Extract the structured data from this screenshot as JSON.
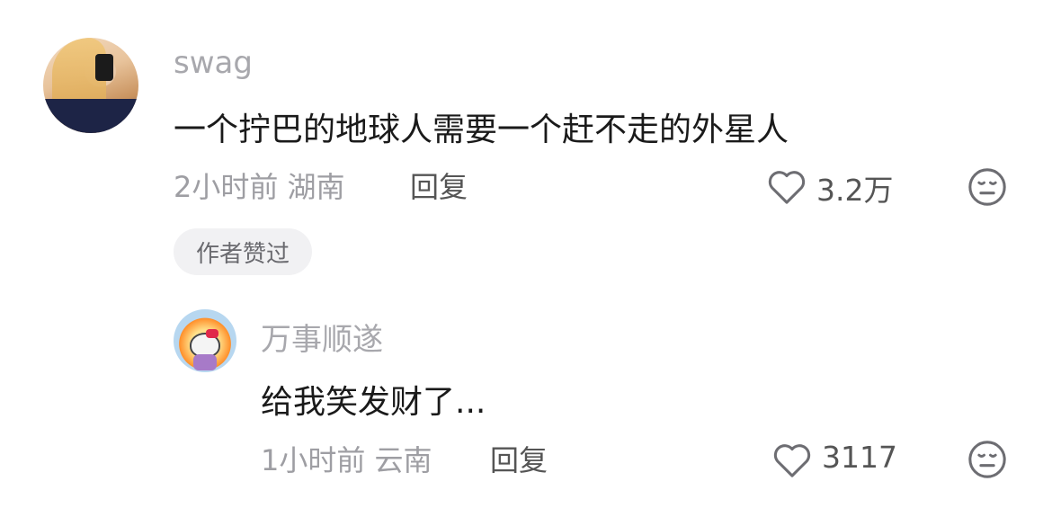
{
  "comment": {
    "username": "swag",
    "text": "一个拧巴的地球人需要一个赶不走的外星人",
    "time_location": "2小时前 湖南",
    "reply_label": "回复",
    "like_count": "3.2万",
    "author_badge": "作者赞过",
    "icons": {
      "like": "heart-outline-icon",
      "emoji": "expressionless-face-icon"
    }
  },
  "reply": {
    "username": "万事顺遂",
    "text": "给我笑发财了...",
    "time_location": "1小时前 云南",
    "reply_label": "回复",
    "like_count": "3117",
    "icons": {
      "like": "heart-outline-icon",
      "emoji": "expressionless-face-icon"
    }
  }
}
